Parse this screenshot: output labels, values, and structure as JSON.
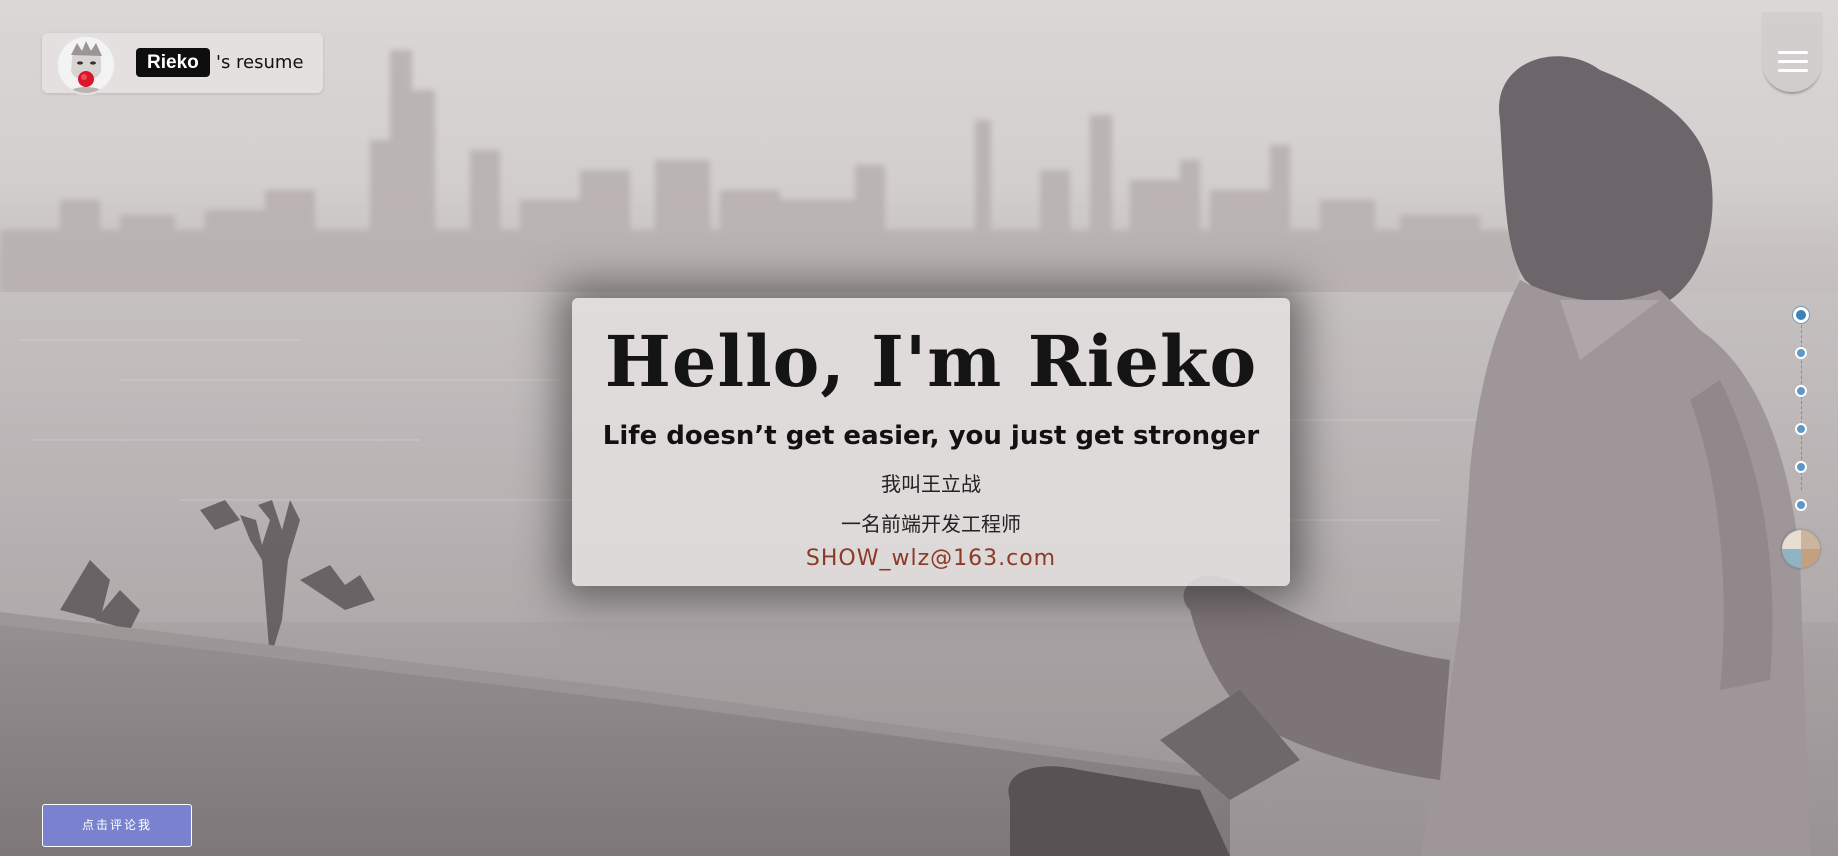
{
  "header": {
    "name_badge": "Rieko",
    "name_suffix": "'s resume",
    "avatar_icon": "avatar-portrait-icon",
    "menu_icon": "hamburger-menu-icon"
  },
  "hero": {
    "headline": "Hello, I'm Rieko",
    "tagline": "Life doesn’t get easier, you just get stronger",
    "intro_name": "我叫王立战",
    "intro_role": "一名前端开发工程师",
    "email": "SHOW_wlz@163.com"
  },
  "side_nav": {
    "active_index": 0,
    "sections": [
      "section-1",
      "section-2",
      "section-3",
      "section-4",
      "section-5",
      "section-6"
    ],
    "music_icon": "music-disc-icon"
  },
  "footer": {
    "comment_button": "点击评论我"
  },
  "colors": {
    "email": "#8b3a25",
    "comment_button": "#7a82cf",
    "nav_dot": "#5f98c6",
    "badge_bg": "#0e0e0e"
  }
}
